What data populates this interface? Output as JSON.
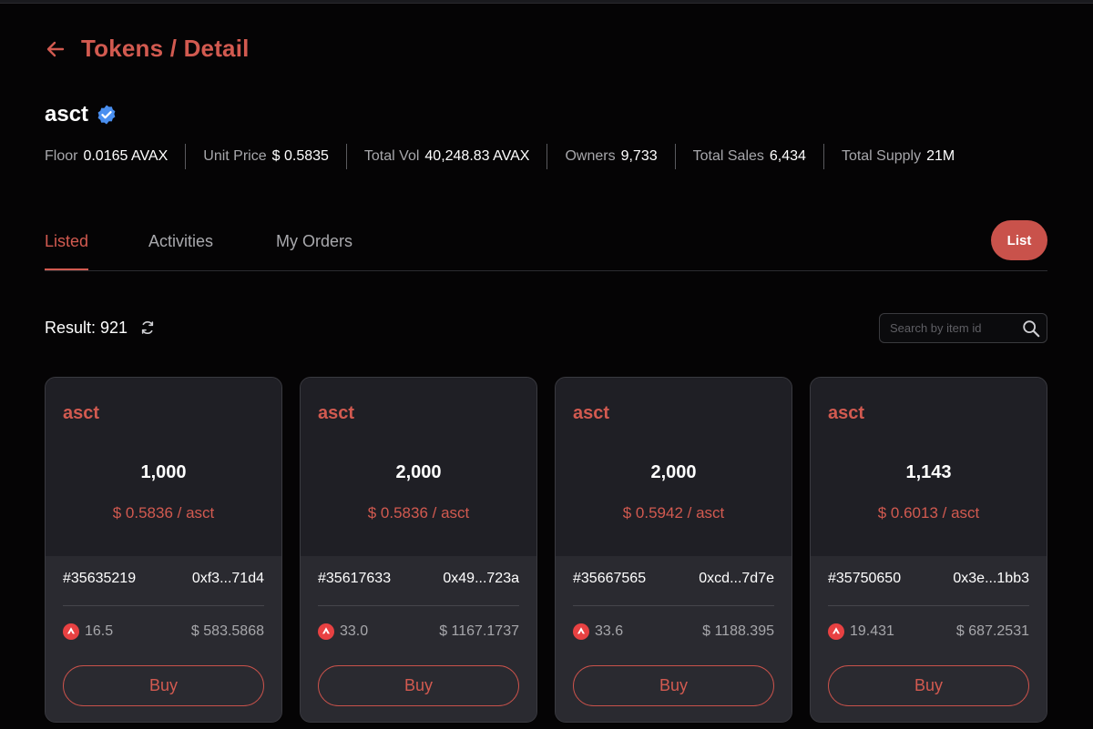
{
  "header": {
    "title": "Tokens / Detail"
  },
  "token": {
    "name": "asct"
  },
  "stats": [
    {
      "label": "Floor",
      "value": "0.0165 AVAX"
    },
    {
      "label": "Unit Price",
      "value": "$ 0.5835"
    },
    {
      "label": "Total Vol",
      "value": "40,248.83 AVAX"
    },
    {
      "label": "Owners",
      "value": "9,733"
    },
    {
      "label": "Total Sales",
      "value": "6,434"
    },
    {
      "label": "Total Supply",
      "value": "21M"
    }
  ],
  "tabs": [
    {
      "label": "Listed",
      "active": true
    },
    {
      "label": "Activities",
      "active": false
    },
    {
      "label": "My Orders",
      "active": false
    }
  ],
  "list_button": "List",
  "result": {
    "label": "Result: 921"
  },
  "search": {
    "placeholder": "Search by item id"
  },
  "cards": [
    {
      "symbol": "asct",
      "amount": "1,000",
      "unit_price": "$ 0.5836 / asct",
      "id": "#35635219",
      "address": "0xf3...71d4",
      "avax": "16.5",
      "usd": "$ 583.5868",
      "buy": "Buy"
    },
    {
      "symbol": "asct",
      "amount": "2,000",
      "unit_price": "$ 0.5836 / asct",
      "id": "#35617633",
      "address": "0x49...723a",
      "avax": "33.0",
      "usd": "$ 1167.1737",
      "buy": "Buy"
    },
    {
      "symbol": "asct",
      "amount": "2,000",
      "unit_price": "$ 0.5942 / asct",
      "id": "#35667565",
      "address": "0xcd...7d7e",
      "avax": "33.6",
      "usd": "$ 1188.395",
      "buy": "Buy"
    },
    {
      "symbol": "asct",
      "amount": "1,143",
      "unit_price": "$ 0.6013 / asct",
      "id": "#35750650",
      "address": "0x3e...1bb3",
      "avax": "19.431",
      "usd": "$ 687.2531",
      "buy": "Buy"
    }
  ],
  "colors": {
    "accent": "#d25a50",
    "background": "#050405",
    "card": "#1f1f25",
    "verified": "#4a8ff0",
    "avax": "#e84142"
  },
  "icons": {
    "back": "arrow-left-icon",
    "verified": "verified-badge-icon",
    "refresh": "refresh-icon",
    "search": "search-icon",
    "avax": "avax-logo-icon"
  }
}
